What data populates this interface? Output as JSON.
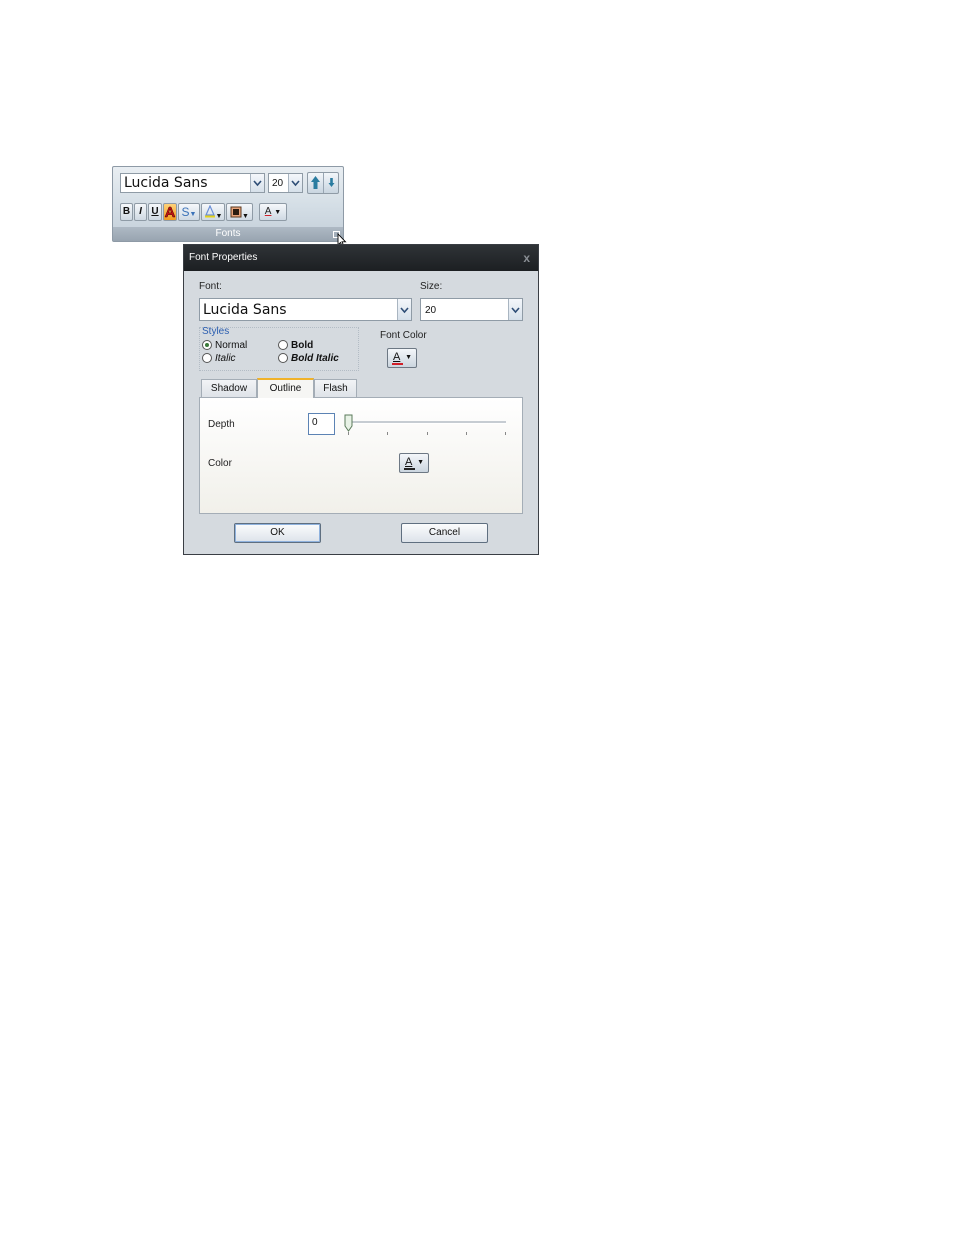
{
  "ribbon": {
    "font_name": "Lucida Sans",
    "font_size": "20",
    "group_label": "Fonts",
    "buttons": {
      "bold": "B",
      "italic": "I",
      "underline": "U",
      "strikethrough": "S",
      "font_color": "A"
    }
  },
  "dialog": {
    "title": "Font Properties",
    "close": "x",
    "font_label": "Font:",
    "font_value": "Lucida Sans",
    "size_label": "Size:",
    "size_value": "20",
    "styles_legend": "Styles",
    "styles": [
      {
        "label": "Normal",
        "checked": true
      },
      {
        "label": "Bold",
        "checked": false
      },
      {
        "label": "Italic",
        "checked": false
      },
      {
        "label": "Bold Italic",
        "checked": false
      }
    ],
    "font_color_label": "Font Color",
    "font_color_glyph": "A",
    "tabs": [
      {
        "label": "Shadow",
        "active": false
      },
      {
        "label": "Outline",
        "active": true
      },
      {
        "label": "Flash",
        "active": false
      }
    ],
    "outline": {
      "depth_label": "Depth",
      "depth_value": "0",
      "color_label": "Color",
      "color_glyph": "A"
    },
    "ok": "OK",
    "cancel": "Cancel"
  },
  "colors": {
    "font_color_bar": "#d0202a",
    "outline_color_bar": "#222222",
    "tab_active_accent": "#f0b22a",
    "styles_legend": "#2a5db0"
  }
}
